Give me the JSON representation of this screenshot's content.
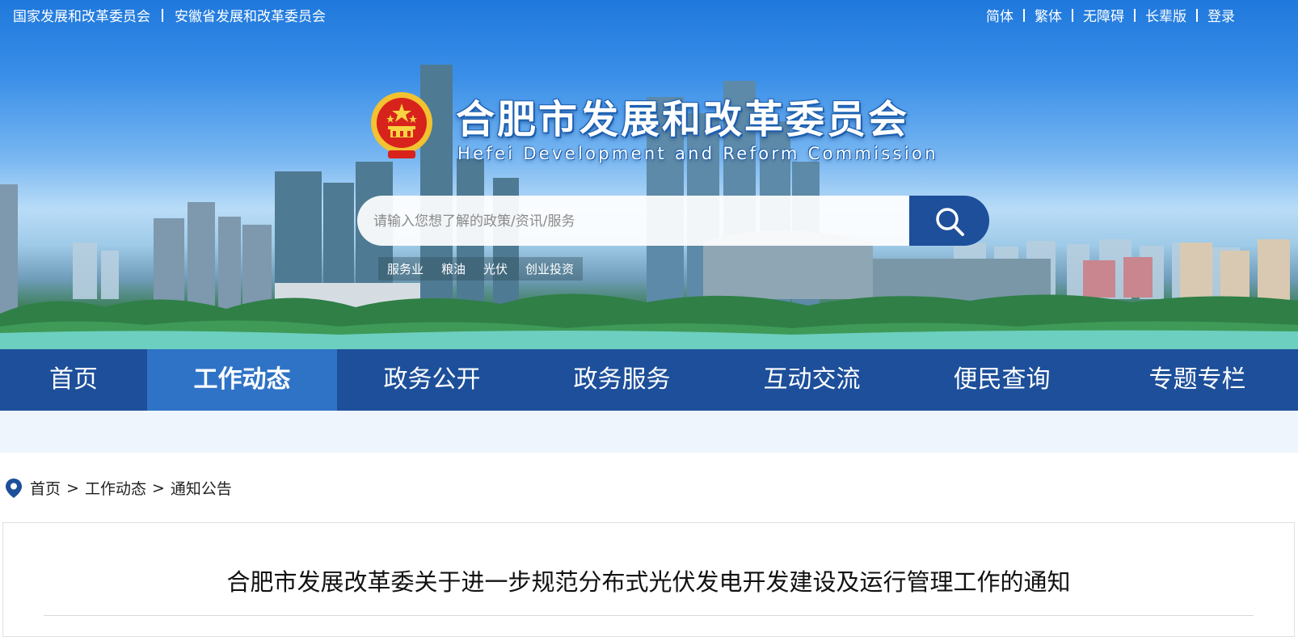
{
  "top_links": {
    "left": [
      "国家发展和改革委员会",
      "安徽省发展和改革委员会"
    ],
    "right": [
      "简体",
      "繁体",
      "无障碍",
      "长辈版",
      "登录"
    ]
  },
  "header": {
    "title": "合肥市发展和改革委员会",
    "subtitle": "Hefei Development and Reform Commission",
    "emblem_icon": "national-emblem-icon"
  },
  "search": {
    "placeholder": "请输入您想了解的政策/资讯/服务",
    "value": "",
    "button_icon": "search-icon",
    "hot_words": [
      "服务业",
      "粮油",
      "光伏",
      "创业投资"
    ]
  },
  "nav": {
    "items": [
      {
        "label": "首页",
        "active": false
      },
      {
        "label": "工作动态",
        "active": true
      },
      {
        "label": "政务公开",
        "active": false
      },
      {
        "label": "政务服务",
        "active": false
      },
      {
        "label": "互动交流",
        "active": false
      },
      {
        "label": "便民查询",
        "active": false
      },
      {
        "label": "专题专栏",
        "active": false
      }
    ]
  },
  "breadcrumb": {
    "icon": "location-pin-icon",
    "items": [
      "首页",
      "工作动态",
      "通知公告"
    ],
    "separator": ">"
  },
  "article": {
    "title": "合肥市发展改革委关于进一步规范分布式光伏发电开发建设及运行管理工作的通知"
  },
  "colors": {
    "nav_bg": "#1d4f9a",
    "nav_active": "#2f73c6",
    "sky_top": "#1f78dc",
    "search_button": "#1d4f9a",
    "strip_bg": "#eef5fc"
  }
}
